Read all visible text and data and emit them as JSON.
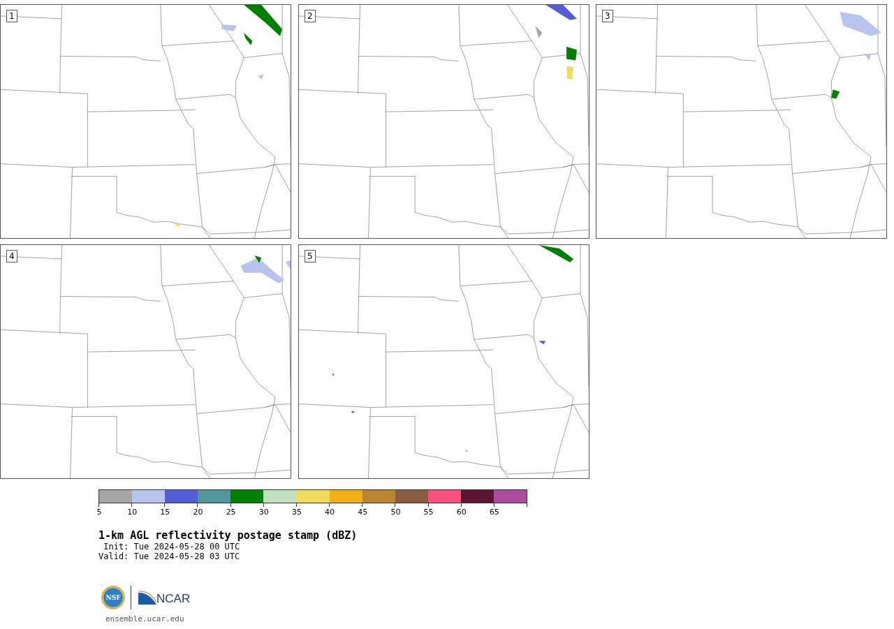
{
  "panels": [
    {
      "label": "1"
    },
    {
      "label": "2"
    },
    {
      "label": "3"
    },
    {
      "label": "4"
    },
    {
      "label": "5"
    }
  ],
  "colorbar": {
    "bins": [
      {
        "color": "#a6a6a6",
        "label": "5"
      },
      {
        "color": "#b8c4ee",
        "label": "10"
      },
      {
        "color": "#525ed6",
        "label": "15"
      },
      {
        "color": "#52979b",
        "label": "20"
      },
      {
        "color": "#008000",
        "label": "25"
      },
      {
        "color": "#bfdfbe",
        "label": "30"
      },
      {
        "color": "#f0da5e",
        "label": "35"
      },
      {
        "color": "#f1ae17",
        "label": "40"
      },
      {
        "color": "#bb8431",
        "label": "45"
      },
      {
        "color": "#8b5b40",
        "label": "50"
      },
      {
        "color": "#f7507f",
        "label": "55"
      },
      {
        "color": "#5d1534",
        "label": "60"
      },
      {
        "color": "#ad4ba0",
        "label": "65"
      }
    ]
  },
  "title": "1-km AGL reflectivity postage stamp (dBZ)",
  "init": " Init: Tue 2024-05-28 00 UTC",
  "valid": "Valid: Tue 2024-05-28 03 UTC",
  "logos": {
    "nsf": "NSF",
    "ncar": "NCAR"
  },
  "url": "ensemble.ucar.edu"
}
